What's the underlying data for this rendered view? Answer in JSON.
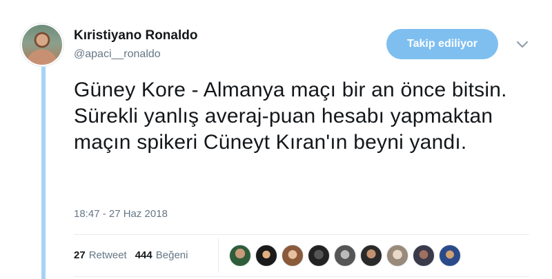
{
  "user": {
    "display_name": "Kıristiyano Ronaldo",
    "handle": "@apaci__ronaldo"
  },
  "follow_button_label": "Takip ediliyor",
  "tweet": {
    "text": "Güney Kore - Almanya maçı bir an önce bitsin. Sürekli yanlış averaj-puan hesabı yapmaktan maçın spikeri Cüneyt Kıran'ın beyni yandı.",
    "timestamp": "18:47 - 27 Haz 2018"
  },
  "stats": {
    "retweet_count": "27",
    "retweet_label": "Retweet",
    "like_count": "444",
    "like_label": "Beğeni"
  },
  "colors": {
    "accent": "#1da1f2",
    "follow_button": "#7fbff0",
    "thread_line": "#a6d3f5",
    "secondary_text": "#657786"
  },
  "icons": {
    "menu": "chevron-down-icon"
  }
}
